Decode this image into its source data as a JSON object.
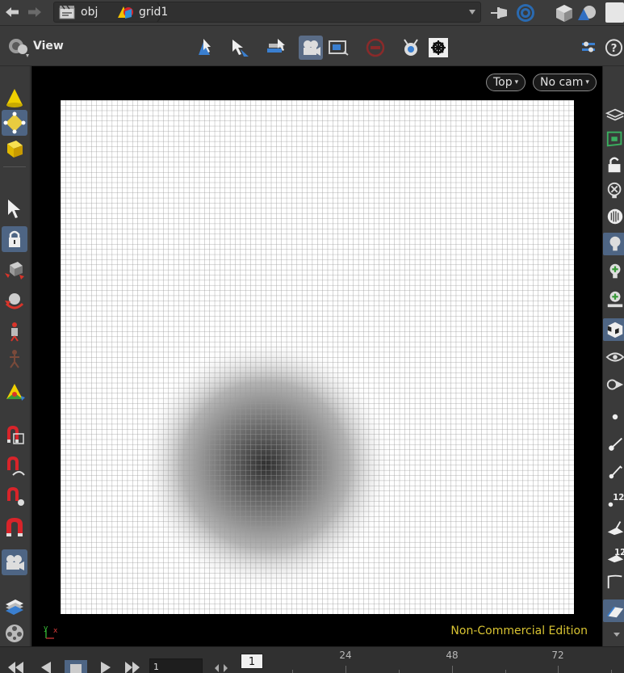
{
  "path_bar": {
    "back_icon": "back-arrow-icon",
    "forward_icon": "forward-arrow-icon",
    "crumbs": [
      {
        "label": "obj",
        "icon": "obj-network-icon"
      },
      {
        "label": "grid1",
        "icon": "geometry-object-icon"
      }
    ]
  },
  "view_toolbar": {
    "label": "View"
  },
  "viewport": {
    "view_menu": "Top",
    "camera_menu": "No cam",
    "watermark": "Non-Commercial Edition",
    "axis_labels": {
      "y": "y",
      "x": "x"
    },
    "grid": {
      "divisions": 100,
      "line_color": "#9a9a9a",
      "background": "#ffffff",
      "blob": {
        "center": [
          0.4,
          0.71
        ],
        "radius": 0.25,
        "peak_color": "#2f2f2f"
      }
    }
  },
  "timeline": {
    "current_frame": "1",
    "frame_field": "1",
    "tick_labels": [
      "24",
      "48",
      "72"
    ]
  },
  "colors": {
    "active_tool": "#4e6584",
    "watermark": "#d8c332"
  }
}
